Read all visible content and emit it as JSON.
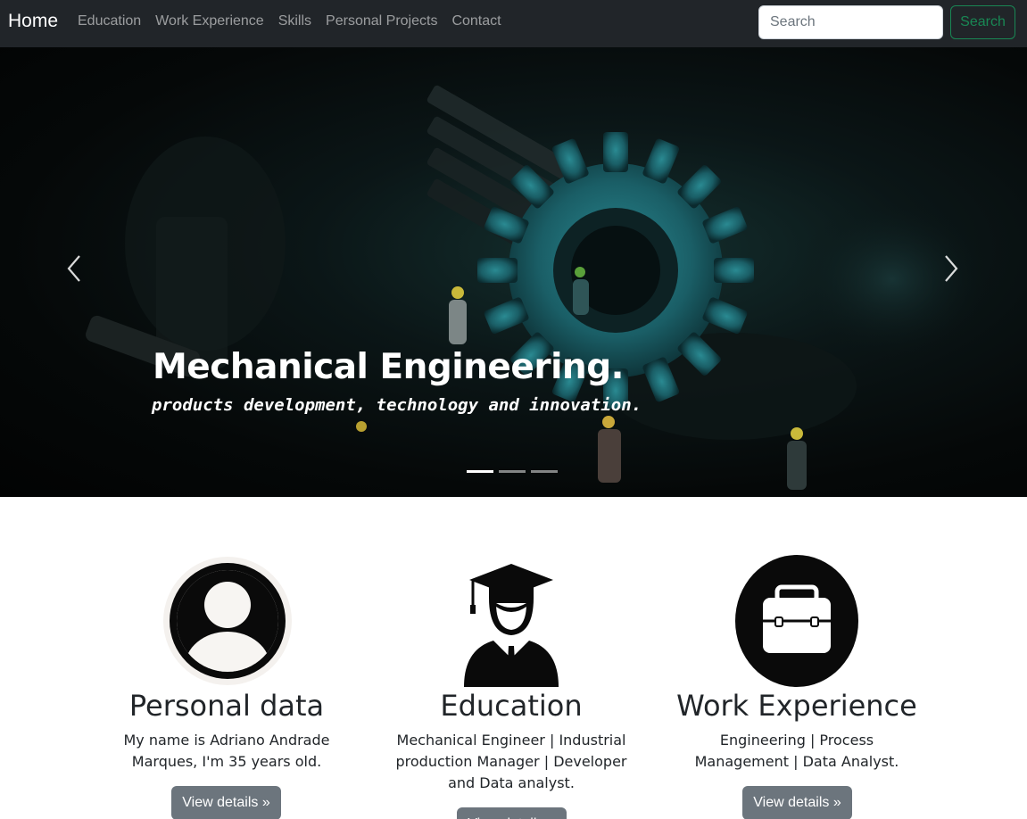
{
  "navbar": {
    "brand": "Home",
    "links": [
      "Education",
      "Work Experience",
      "Skills",
      "Personal Projects",
      "Contact"
    ],
    "search_placeholder": "Search",
    "search_button": "Search"
  },
  "carousel": {
    "title": "Mechanical Engineering.",
    "subtitle": "products development, technology and innovation.",
    "active_slide": 1,
    "slide_count": 3
  },
  "cards": [
    {
      "heading": "Personal data",
      "text": "My name is Adriano Andrade Marques, I'm 35 years old.",
      "button": "View details »",
      "icon": "person-icon"
    },
    {
      "heading": "Education",
      "text": "Mechanical Engineer | Industrial production Manager | Developer and Data analyst.",
      "button": "View details »",
      "icon": "graduate-icon"
    },
    {
      "heading": "Work Experience",
      "text": "Engineering | Process Management | Data Analyst.",
      "button": "View details »",
      "icon": "briefcase-icon"
    }
  ],
  "colors": {
    "navbar_bg": "#212529",
    "search_accent": "#198754",
    "button_bg": "#6c757d"
  }
}
